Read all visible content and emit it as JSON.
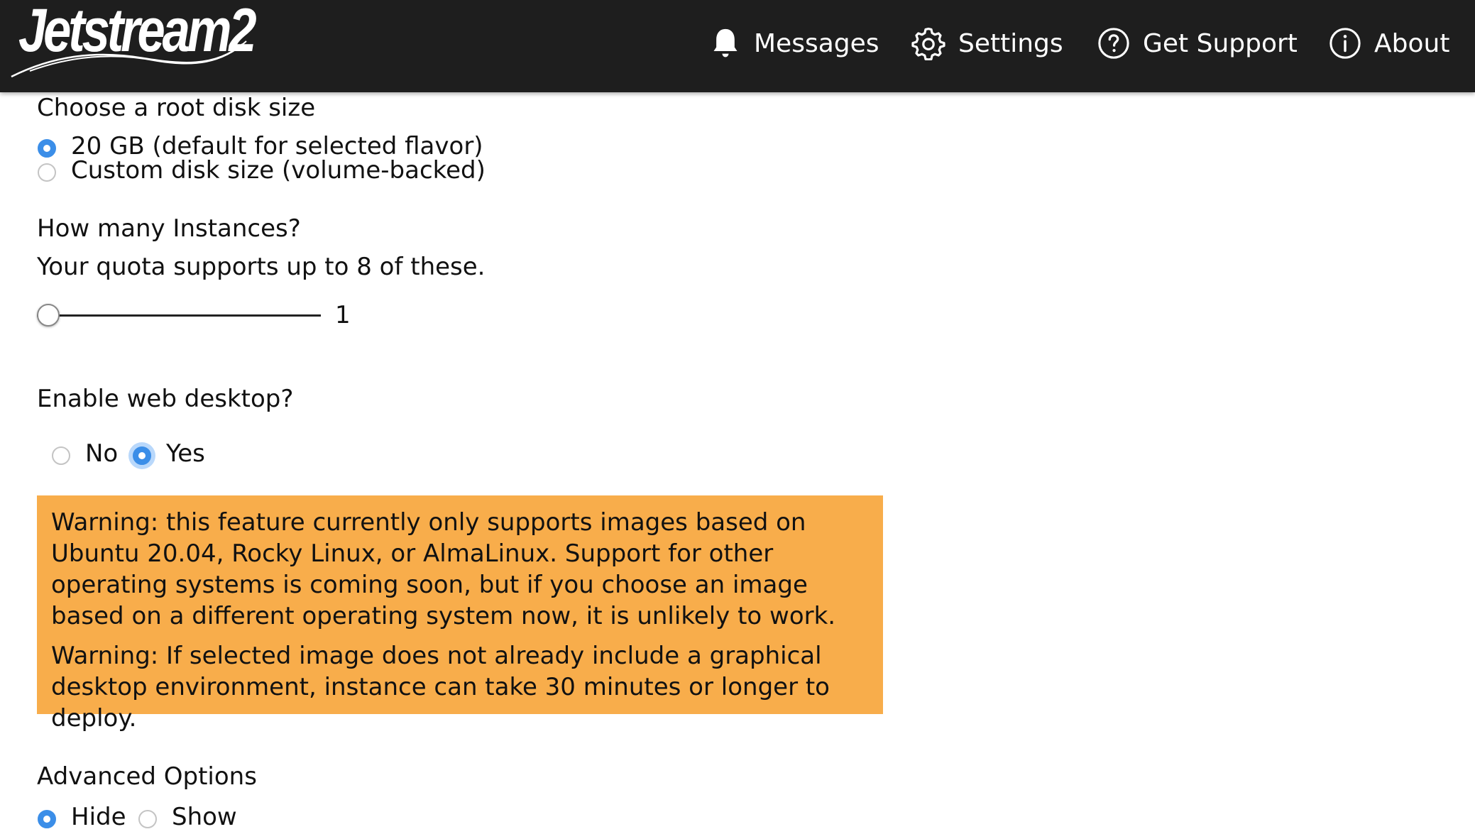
{
  "header": {
    "logo_text": "Jetstream2",
    "nav": [
      {
        "label": "Messages",
        "icon": "bell-icon"
      },
      {
        "label": "Settings",
        "icon": "gear-icon"
      },
      {
        "label": "Get Support",
        "icon": "help-circle-icon"
      },
      {
        "label": "About",
        "icon": "info-circle-icon"
      }
    ]
  },
  "root_disk": {
    "title": "Choose a root disk size",
    "options": [
      {
        "label": "20 GB (default for selected flavor)",
        "selected": true
      },
      {
        "label": "Custom disk size (volume-backed)",
        "selected": false
      }
    ]
  },
  "instances": {
    "title": "How many Instances?",
    "quota_text": "Your quota supports up to 8 of these.",
    "slider_value": "1",
    "slider_min": 1,
    "slider_max": 8
  },
  "web_desktop": {
    "title": "Enable web desktop?",
    "options": [
      {
        "label": "No",
        "selected": false
      },
      {
        "label": "Yes",
        "selected": true
      }
    ]
  },
  "warnings": [
    "Warning: this feature currently only supports images based on Ubuntu 20.04, Rocky Linux, or AlmaLinux. Support for other operating systems is coming soon, but if you choose an image based on a different operating system now, it is unlikely to work.",
    "Warning: If selected image does not already include a graphical desktop environment, instance can take 30 minutes or longer to deploy."
  ],
  "advanced": {
    "title": "Advanced Options",
    "options": [
      {
        "label": "Hide",
        "selected": true
      },
      {
        "label": "Show",
        "selected": false
      }
    ]
  },
  "colors": {
    "topbar": "#1e1e1e",
    "accent": "#3b8ee8",
    "warning_bg": "#f8ad4b"
  }
}
